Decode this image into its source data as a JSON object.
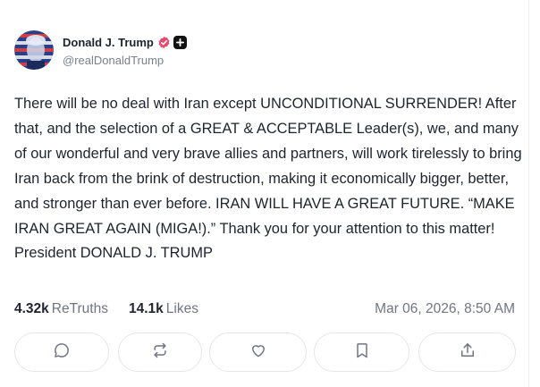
{
  "author": {
    "display_name": "Donald J. Trump",
    "handle": "@realDonaldTrump",
    "verified_icon": "verified-badge-icon",
    "extra_badge_icon": "plus-badge-icon"
  },
  "post": {
    "text": "There will be no deal with Iran except UNCONDITIONAL SURRENDER! After that, and the selection of a GREAT & ACCEPTABLE Leader(s), we, and many of our wonderful and very brave allies and partners, will work tirelessly to bring Iran back from the brink of destruction, making it economically bigger, better, and stronger than ever before. IRAN WILL HAVE A GREAT FUTURE. “MAKE IRAN GREAT AGAIN (MIGA!).” Thank you for your attention to this matter! President DONALD J. TRUMP"
  },
  "stats": {
    "retruths_count": "4.32k",
    "retruths_label": "ReTruths",
    "likes_count": "14.1k",
    "likes_label": "Likes",
    "timestamp": "Mar 06, 2026, 8:50 AM"
  },
  "actions": [
    {
      "icon": "reply-icon"
    },
    {
      "icon": "retruth-icon"
    },
    {
      "icon": "like-icon"
    },
    {
      "icon": "bookmark-icon"
    },
    {
      "icon": "share-icon"
    }
  ],
  "colors": {
    "verified": "#e84a6f",
    "text": "#1f2330",
    "muted": "#6f7584",
    "border": "#e3e6ec"
  }
}
